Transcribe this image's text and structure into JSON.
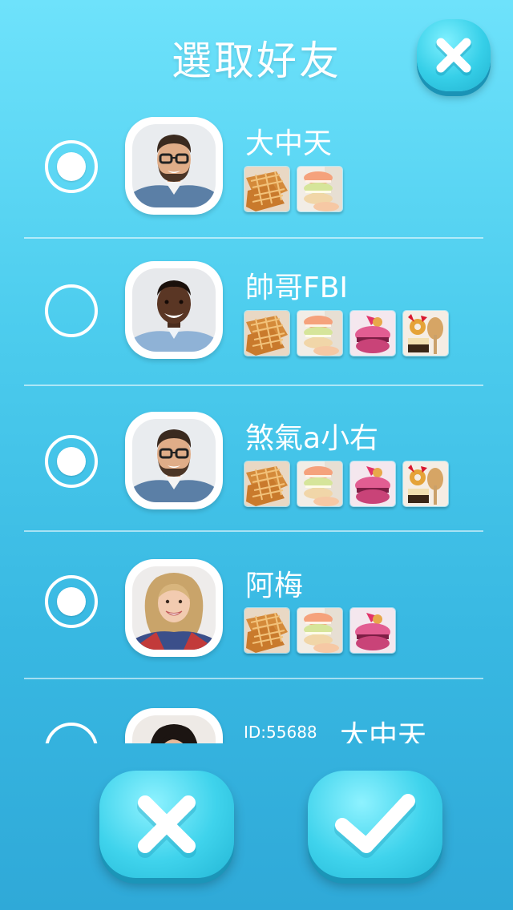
{
  "header": {
    "title": "選取好友",
    "close_icon": "close-icon"
  },
  "friends": [
    {
      "name": "大中天",
      "selected": true,
      "avatar": "man-glasses-avatar",
      "items": [
        "waffle",
        "macaron-stack"
      ]
    },
    {
      "name": "帥哥FBI",
      "selected": false,
      "avatar": "man-smiling-avatar",
      "items": [
        "waffle",
        "macaron-stack",
        "pink-macaron",
        "donut-cake"
      ]
    },
    {
      "name": "煞氣a小右",
      "selected": true,
      "avatar": "man-glasses-avatar",
      "items": [
        "waffle",
        "macaron-stack",
        "pink-macaron",
        "donut-cake"
      ]
    },
    {
      "name": "阿梅",
      "selected": true,
      "avatar": "woman-blonde-avatar",
      "items": [
        "waffle",
        "macaron-stack",
        "pink-macaron"
      ]
    },
    {
      "name": "大中天",
      "id_label": "ID:55688",
      "selected": false,
      "avatar": "woman-dark-hair-avatar",
      "items": []
    }
  ],
  "footer": {
    "cancel_icon": "x-icon",
    "confirm_icon": "check-icon"
  },
  "colors": {
    "bg_top": "#6ee2fb",
    "bg_bottom": "#2fa9d8",
    "button": "#3fd3ec"
  }
}
